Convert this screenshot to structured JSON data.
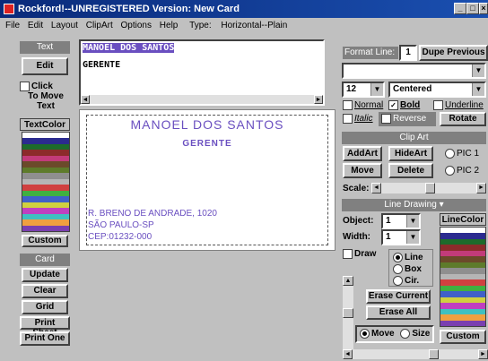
{
  "window": {
    "title": "Rockford!--UNREGISTERED Version: New Card",
    "min": "_",
    "max": "□",
    "close": "×"
  },
  "menu": {
    "file": "File",
    "edit": "Edit",
    "layout": "Layout",
    "clipart": "ClipArt",
    "options": "Options",
    "help": "Help",
    "type_label": "Type:",
    "type_value": "Horizontal--Plain"
  },
  "left": {
    "text_header": "Text",
    "edit_button": "Edit",
    "click_move": [
      "Click",
      "To Move",
      "Text"
    ],
    "textcolor_header": "TextColor",
    "custom_button": "Custom",
    "card_header": "Card",
    "update": "Update",
    "clear": "Clear",
    "grid": "Grid",
    "print_sheet": "Print Sheet",
    "print_one": "Print One"
  },
  "editor": {
    "line1": "MANOEL DOS SANTOS",
    "line2": "GERENTE"
  },
  "card": {
    "name": "MANOEL DOS SANTOS",
    "title": "GERENTE",
    "addr1": "R. BRENO DE ANDRADE, 1020",
    "addr2": "SÃO PAULO-SP",
    "addr3": "CEP:01232-000"
  },
  "right": {
    "format_line_label": "Format Line:",
    "format_line_value": "1",
    "dupe_previous": "Dupe Previous",
    "font_dd": "",
    "size_value": "12",
    "align_value": "Centered",
    "normal": "Normal",
    "bold": "Bold",
    "underline": "Underline",
    "italic": "Italic",
    "reverse": "Reverse",
    "rotate": "Rotate",
    "clipart_header": "Clip Art",
    "addart": "AddArt",
    "hideart": "HideArt",
    "pic1": "PIC 1",
    "move": "Move",
    "delete": "Delete",
    "pic2": "PIC 2",
    "scale_label": "Scale:",
    "linedrawing_header": "Line Drawing",
    "object_label": "Object:",
    "object_value": "1",
    "width_label": "Width:",
    "width_value": "1",
    "linecolor_header": "LineColor",
    "draw": "Draw",
    "line": "Line",
    "box": "Box",
    "cir": "Cir.",
    "erase_current": "Erase Current",
    "erase_all": "Erase All",
    "move_radio": "Move",
    "size_radio": "Size",
    "custom_button": "Custom"
  },
  "colors": {
    "palette": [
      "#ffffff",
      "#2b2b8f",
      "#1d6b2b",
      "#8c2b2b",
      "#c23b7a",
      "#6b4a2a",
      "#5e7b2b",
      "#8f8f8f",
      "#b5b5b5",
      "#d04040",
      "#40b040",
      "#4060c8",
      "#d0d040",
      "#c040c0",
      "#40c0c0",
      "#f0a040",
      "#7a3fb0"
    ],
    "cardtext": "#6a4fc0"
  }
}
